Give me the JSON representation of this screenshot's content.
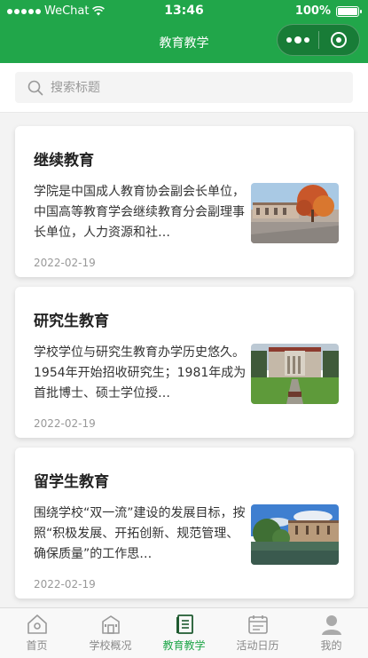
{
  "status_bar": {
    "carrier": "WeChat",
    "time": "13:46",
    "battery": "100%"
  },
  "nav": {
    "title": "教育教学"
  },
  "search": {
    "placeholder": "搜索标题"
  },
  "articles": [
    {
      "title": "继续教育",
      "summary": "学院是中国成人教育协会副会长单位，中国高等教育学会继续教育分会副理事长单位，人力资源和社…",
      "date": "2022-02-19",
      "thumbnail": "campus-autumn-tree"
    },
    {
      "title": "研究生教育",
      "summary": "学校学位与研究生教育办学历史悠久。1954年开始招收研究生；1981年成为首批博士、硕士学位授…",
      "date": "2022-02-19",
      "thumbnail": "campus-main-building"
    },
    {
      "title": "留学生教育",
      "summary": "围绕学校“双一流”建设的发展目标，按照“积极发展、开拓创新、规范管理、确保质量”的工作思…",
      "date": "2022-02-19",
      "thumbnail": "campus-lakeside-building"
    }
  ],
  "tabbar": {
    "active_index": 2,
    "accent_color": "#21a64a",
    "items": [
      {
        "label": "首页",
        "icon": "home-icon"
      },
      {
        "label": "学校概况",
        "icon": "school-icon"
      },
      {
        "label": "教育教学",
        "icon": "book-icon"
      },
      {
        "label": "活动日历",
        "icon": "calendar-icon"
      },
      {
        "label": "我的",
        "icon": "user-icon"
      }
    ]
  }
}
